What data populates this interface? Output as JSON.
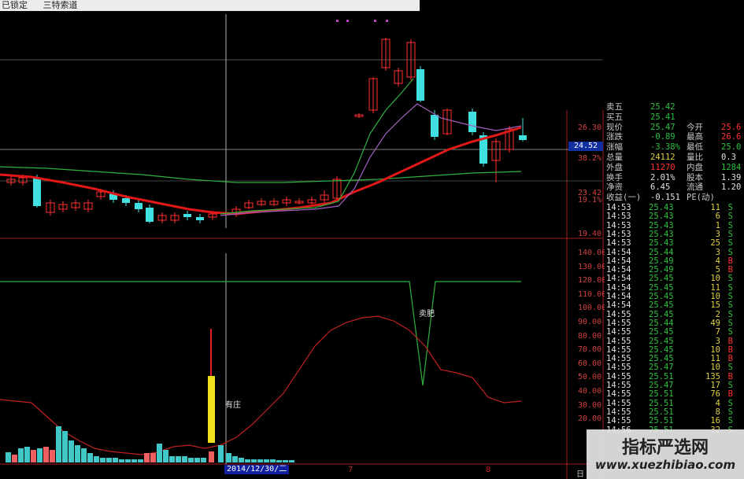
{
  "topbar": {
    "item1": "已锁定",
    "item2": "三特索道"
  },
  "price_axis": [
    "26.30",
    "24.52",
    "38.2%",
    "23.42",
    "19.1%",
    "19.40"
  ],
  "price_tag": "24.52",
  "indicator_axis": [
    "140.00",
    "130.00",
    "120.00",
    "110.00",
    "100.00",
    "90.00",
    "80.00",
    "70.00",
    "60.00",
    "50.00",
    "40.00",
    "30.00",
    "20.00"
  ],
  "annotations": {
    "sell": "卖肥",
    "has_banker": "有庄"
  },
  "date_label": "2014/12/30/二",
  "bottom_marks": [
    "7",
    "8",
    "日"
  ],
  "quote": {
    "rows": [
      {
        "l1": "卖五",
        "v1": "25.42",
        "l2": "",
        "v2": ""
      },
      {
        "l1": "买五",
        "v1": "25.41",
        "l2": "",
        "v2": ""
      },
      {
        "l1": "现价",
        "v1": "25.47",
        "l2": "今开",
        "v2": "25.6"
      },
      {
        "l1": "涨跌",
        "v1": "-0.89",
        "l2": "最高",
        "v2": "26.6"
      },
      {
        "l1": "涨幅",
        "v1": "-3.38%",
        "l2": "最低",
        "v2": "25.0"
      },
      {
        "l1": "总量",
        "v1": "24112",
        "l2": "量比",
        "v2": "0.3"
      },
      {
        "l1": "外盘",
        "v1": "11270",
        "l2": "内盘",
        "v2": "1284"
      },
      {
        "l1": "换手",
        "v1": "2.01%",
        "l2": "股本",
        "v2": "1.39"
      },
      {
        "l1": "净资",
        "v1": "6.45",
        "l2": "流通",
        "v2": "1.20"
      },
      {
        "l1": "收益(一)",
        "v1": "-0.151",
        "l2": "PE(动)",
        "v2": ""
      }
    ]
  },
  "ticks": [
    {
      "t": "14:53",
      "p": "25.43",
      "v": "11",
      "s": "S"
    },
    {
      "t": "14:53",
      "p": "25.43",
      "v": "6",
      "s": "S"
    },
    {
      "t": "14:53",
      "p": "25.43",
      "v": "1",
      "s": "S"
    },
    {
      "t": "14:53",
      "p": "25.43",
      "v": "3",
      "s": "S"
    },
    {
      "t": "14:53",
      "p": "25.43",
      "v": "25",
      "s": "S"
    },
    {
      "t": "14:54",
      "p": "25.44",
      "v": "3",
      "s": "S"
    },
    {
      "t": "14:54",
      "p": "25.49",
      "v": "4",
      "s": "B"
    },
    {
      "t": "14:54",
      "p": "25.49",
      "v": "5",
      "s": "B"
    },
    {
      "t": "14:54",
      "p": "25.45",
      "v": "10",
      "s": "S"
    },
    {
      "t": "14:54",
      "p": "25.45",
      "v": "11",
      "s": "S"
    },
    {
      "t": "14:54",
      "p": "25.45",
      "v": "10",
      "s": "S"
    },
    {
      "t": "14:54",
      "p": "25.45",
      "v": "15",
      "s": "S"
    },
    {
      "t": "14:55",
      "p": "25.45",
      "v": "2",
      "s": "S"
    },
    {
      "t": "14:55",
      "p": "25.44",
      "v": "49",
      "s": "S"
    },
    {
      "t": "14:55",
      "p": "25.45",
      "v": "7",
      "s": "S"
    },
    {
      "t": "14:55",
      "p": "25.45",
      "v": "3",
      "s": "B"
    },
    {
      "t": "14:55",
      "p": "25.45",
      "v": "10",
      "s": "B"
    },
    {
      "t": "14:55",
      "p": "25.45",
      "v": "11",
      "s": "B"
    },
    {
      "t": "14:55",
      "p": "25.47",
      "v": "10",
      "s": "S"
    },
    {
      "t": "14:55",
      "p": "25.51",
      "v": "135",
      "s": "B"
    },
    {
      "t": "14:55",
      "p": "25.47",
      "v": "17",
      "s": "S"
    },
    {
      "t": "14:55",
      "p": "25.51",
      "v": "76",
      "s": "B"
    },
    {
      "t": "14:55",
      "p": "25.51",
      "v": "4",
      "s": "S"
    },
    {
      "t": "14:55",
      "p": "25.51",
      "v": "8",
      "s": "S"
    },
    {
      "t": "14:55",
      "p": "25.51",
      "v": "16",
      "s": "S"
    },
    {
      "t": "14:56",
      "p": "25.51",
      "v": "32",
      "s": "S"
    }
  ],
  "watermark": {
    "line1": "指标严选网",
    "line2": "www.xuezhibiao.com"
  },
  "colors": {
    "bull": "#ff3030",
    "bear": "#40e0e0",
    "ma_red": "#e01818",
    "ma_green": "#30b040",
    "ma_purple": "#a060c0",
    "vol_red": "#f06060",
    "vol_cyan": "#40c8c8",
    "banker": "#f0e020"
  }
}
